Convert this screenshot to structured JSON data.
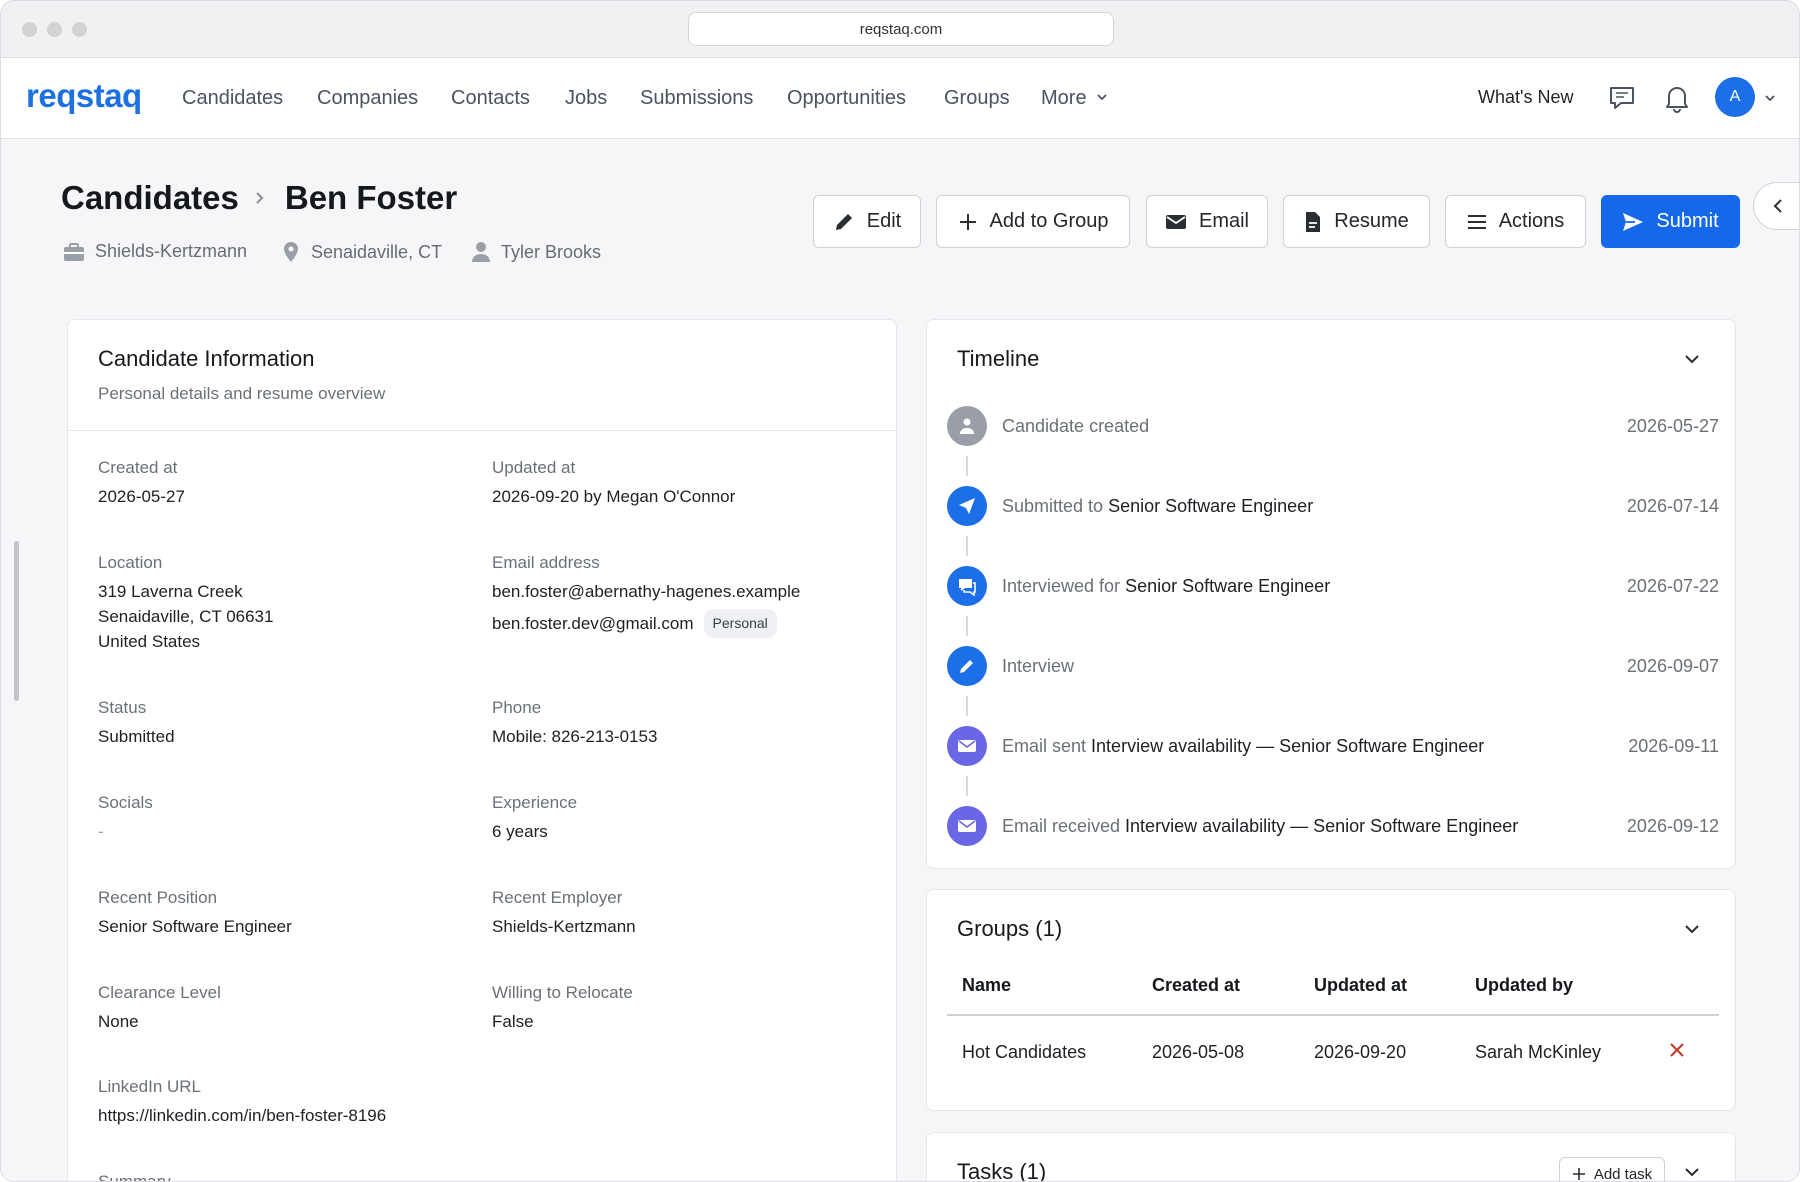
{
  "browser": {
    "url": "reqstaq.com"
  },
  "nav": {
    "logo": "reqstaq",
    "links": [
      "Candidates",
      "Companies",
      "Contacts",
      "Jobs",
      "Submissions",
      "Opportunities",
      "Groups",
      "More"
    ],
    "whats_new": "What's New",
    "avatar_initial": "A"
  },
  "header": {
    "breadcrumb_root": "Candidates",
    "candidate_name": "Ben Foster",
    "company": "Shields-Kertzmann",
    "location": "Senaidaville, CT",
    "owner": "Tyler Brooks"
  },
  "toolbar": {
    "edit": "Edit",
    "add_to_group": "Add to Group",
    "email": "Email",
    "resume": "Resume",
    "actions": "Actions",
    "submit": "Submit"
  },
  "info": {
    "title": "Candidate Information",
    "subtitle": "Personal details and resume overview",
    "fields": {
      "created_at": {
        "label": "Created at",
        "value": "2026-05-27"
      },
      "updated_at": {
        "label": "Updated at",
        "value": "2026-09-20 by Megan O'Connor"
      },
      "location": {
        "label": "Location",
        "line1": "319 Laverna Creek",
        "line2": "Senaidaville, CT 06631",
        "line3": "United States"
      },
      "email": {
        "label": "Email address",
        "primary": "ben.foster@abernathy-hagenes.example",
        "secondary": "ben.foster.dev@gmail.com",
        "secondary_tag": "Personal"
      },
      "status": {
        "label": "Status",
        "value": "Submitted"
      },
      "phone": {
        "label": "Phone",
        "value": "Mobile: 826-213-0153"
      },
      "socials": {
        "label": "Socials",
        "value": "-"
      },
      "experience": {
        "label": "Experience",
        "value": "6 years"
      },
      "recent_position": {
        "label": "Recent Position",
        "value": "Senior Software Engineer"
      },
      "recent_employer": {
        "label": "Recent Employer",
        "value": "Shields-Kertzmann"
      },
      "clearance": {
        "label": "Clearance Level",
        "value": "None"
      },
      "relocate": {
        "label": "Willing to Relocate",
        "value": "False"
      },
      "linkedin": {
        "label": "LinkedIn URL",
        "value": "https://linkedin.com/in/ben-foster-8196"
      },
      "summary": {
        "label": "Summary"
      }
    }
  },
  "timeline": {
    "title": "Timeline",
    "events": [
      {
        "text": "Candidate created",
        "bold": "",
        "date": "2026-05-27",
        "icon": "person-icon",
        "color": "#9a9ea6"
      },
      {
        "text": "Submitted to ",
        "bold": "Senior Software Engineer",
        "date": "2026-07-14",
        "icon": "send-icon",
        "color": "#1c6fe8"
      },
      {
        "text": "Interviewed for ",
        "bold": "Senior Software Engineer",
        "date": "2026-07-22",
        "icon": "chat-icon",
        "color": "#1c6fe8"
      },
      {
        "text": "Interview",
        "bold": "",
        "date": "2026-09-07",
        "icon": "pencil-icon",
        "color": "#1c6fe8"
      },
      {
        "text": "Email sent ",
        "bold": "Interview availability — Senior Software Engineer",
        "date": "2026-09-11",
        "icon": "envelope-icon",
        "color": "#6a67e6"
      },
      {
        "text": "Email received ",
        "bold": "Interview availability — Senior Software Engineer",
        "date": "2026-09-12",
        "icon": "envelope-icon",
        "color": "#6a67e6"
      }
    ]
  },
  "groups": {
    "title": "Groups (1)",
    "columns": [
      "Name",
      "Created at",
      "Updated at",
      "Updated by"
    ],
    "rows": [
      [
        "Hot Candidates",
        "2026-05-08",
        "2026-09-20",
        "Sarah McKinley"
      ]
    ]
  },
  "tasks": {
    "title": "Tasks (1)",
    "add_task": "Add task"
  },
  "colors": {
    "brand": "#1d70e0",
    "primary_button": "#1668eb",
    "remove": "#c0392b"
  }
}
